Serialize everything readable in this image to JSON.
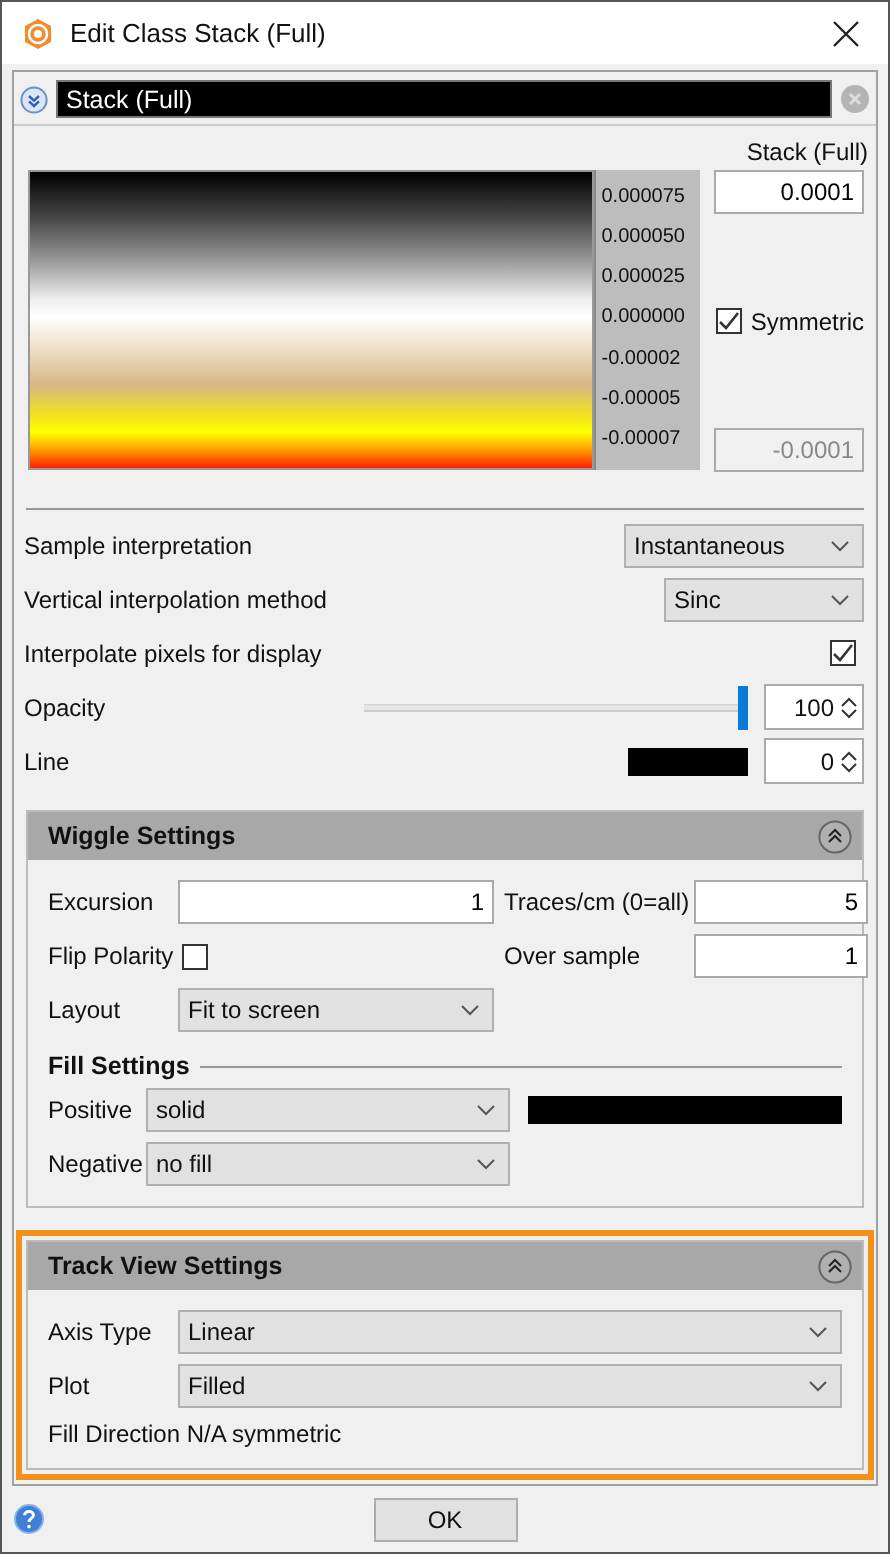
{
  "window": {
    "title": "Edit Class Stack (Full)"
  },
  "search": {
    "value": "Stack (Full)"
  },
  "colorbar": {
    "title": "Stack (Full)",
    "max": "0.0001",
    "min": "-0.0001",
    "symmetric": {
      "label": "Symmetric",
      "checked": true
    },
    "ticks": [
      "0.000075",
      "0.000050",
      "0.000025",
      "0.000000",
      "-0.00002",
      "-0.00005",
      "-0.00007"
    ]
  },
  "properties": [
    {
      "kind": "dropdown",
      "label": "Sample interpretation",
      "value": "Instantaneous"
    },
    {
      "kind": "dropdown",
      "label": "Vertical interpolation method",
      "value": "Sinc"
    },
    {
      "kind": "checkbox",
      "label": "Interpolate pixels for display",
      "checked": true
    },
    {
      "kind": "slider",
      "label": "Opacity",
      "level": 1,
      "value": "100"
    },
    {
      "kind": "swatch",
      "label": "Line",
      "value": "0"
    }
  ],
  "wiggle": {
    "title": "Wiggle Settings",
    "expanded": true,
    "highlighted": false,
    "excursion": {
      "label": "Excursion",
      "value": "1"
    },
    "traces": {
      "label": "Traces/cm (0=all)",
      "value": "5"
    },
    "flip": {
      "label": "Flip Polarity",
      "checked": false
    },
    "oversample": {
      "label": "Over sample",
      "value": "1"
    },
    "layout": {
      "label": "Layout",
      "value": "Fit to screen"
    },
    "fill": {
      "title": "Fill Settings",
      "positive": {
        "label": "Positive",
        "value": "solid"
      },
      "negative": {
        "label": "Negative",
        "value": "no fill"
      }
    }
  },
  "track": {
    "title": "Track View Settings",
    "expanded": true,
    "highlighted": true,
    "axis": {
      "label": "Axis Type",
      "value": "Linear"
    },
    "plot": {
      "label": "Plot",
      "value": "Filled"
    },
    "note": "Fill Direction N/A symmetric"
  },
  "buttons": [
    "OK"
  ]
}
